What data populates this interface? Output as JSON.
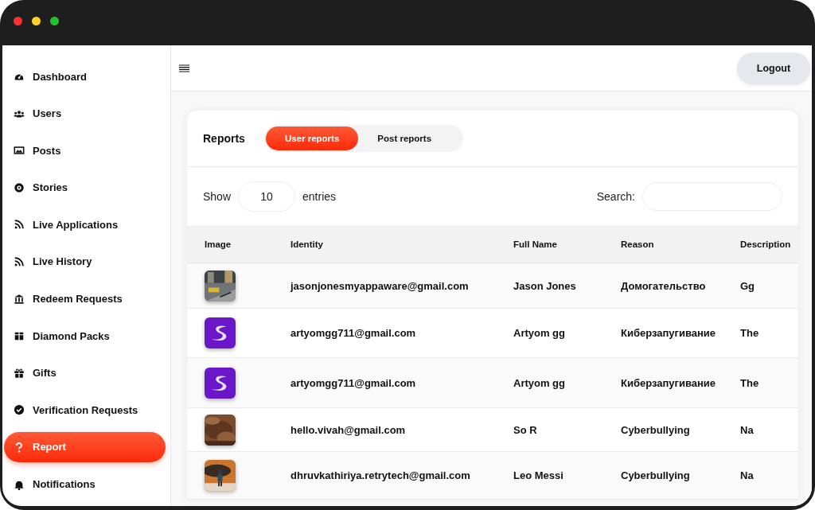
{
  "sidebar": {
    "items": [
      {
        "label": "Dashboard",
        "selected": false
      },
      {
        "label": "Users",
        "selected": false
      },
      {
        "label": "Posts",
        "selected": false
      },
      {
        "label": "Stories",
        "selected": false
      },
      {
        "label": "Live Applications",
        "selected": false
      },
      {
        "label": "Live History",
        "selected": false
      },
      {
        "label": "Redeem Requests",
        "selected": false
      },
      {
        "label": "Diamond Packs",
        "selected": false
      },
      {
        "label": "Gifts",
        "selected": false
      },
      {
        "label": "Verification Requests",
        "selected": false
      },
      {
        "label": "Report",
        "selected": true
      },
      {
        "label": "Notifications",
        "selected": false
      }
    ]
  },
  "header": {
    "logout": "Logout"
  },
  "reports": {
    "title": "Reports",
    "tabs": [
      {
        "label": "User reports",
        "selected": true
      },
      {
        "label": "Post reports",
        "selected": false
      }
    ],
    "length": {
      "before": "Show",
      "value": "10",
      "after": "entries"
    },
    "search": {
      "label": "Search:"
    },
    "table": {
      "columns": [
        "Image",
        "Identity",
        "Full Name",
        "Reason",
        "Description"
      ],
      "rows": [
        {
          "identity": "jasonjonesmyappaware@gmail.com",
          "full_name": "Jason Jones",
          "reason": "Домогательство",
          "description": "Gg"
        },
        {
          "image": {
            "kind": "logo"
          },
          "identity": "artyomgg711@gmail.com",
          "full_name": "Artyom gg",
          "reason": "Киберзапугивание",
          "description": "The"
        },
        {
          "image": {
            "kind": "logo"
          },
          "identity": "artyomgg711@gmail.com",
          "full_name": "Artyom gg",
          "reason": "Киберзапугивание",
          "description": "The"
        },
        {
          "identity": "hello.vivah@gmail.com",
          "full_name": "So R",
          "reason": "Cyberbullying",
          "description": "Na"
        },
        {
          "identity": "dhruvkathiriya.retrytech@gmail.com",
          "full_name": "Leo Messi",
          "reason": "Cyberbullying",
          "description": "Na"
        }
      ]
    }
  }
}
